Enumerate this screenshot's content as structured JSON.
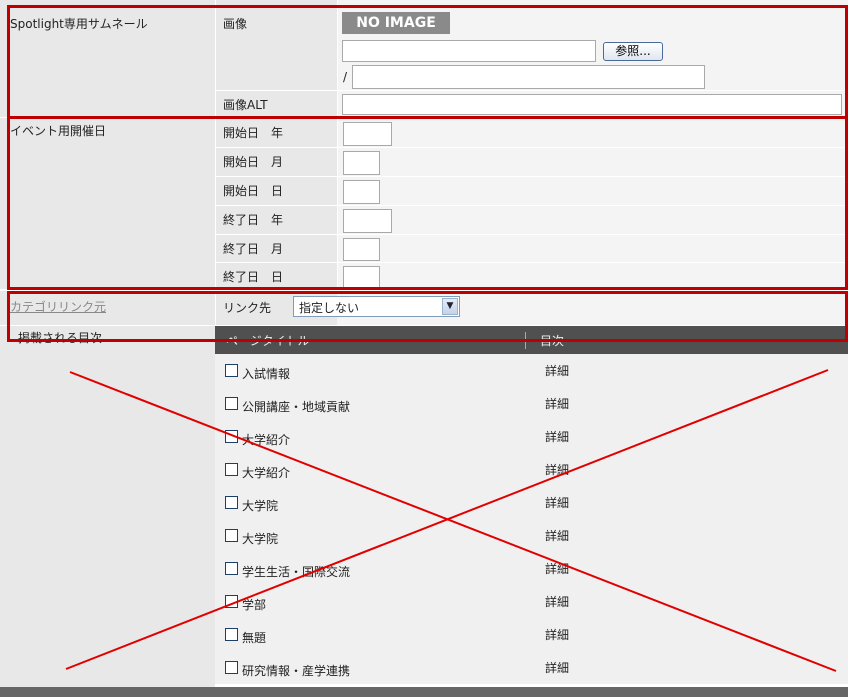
{
  "thumbnail": {
    "label": "Spotlight専用サムネール",
    "image_label": "画像",
    "no_image_text": "NO IMAGE",
    "browse_button": "参照...",
    "path_prefix": "/",
    "alt_label": "画像ALT",
    "file_value": "",
    "path_value": "",
    "alt_value": ""
  },
  "event": {
    "label": "イベント用開催日",
    "fields": [
      {
        "label": "開始日　年",
        "value": ""
      },
      {
        "label": "開始日　月",
        "value": ""
      },
      {
        "label": "開始日　日",
        "value": ""
      },
      {
        "label": "終了日　年",
        "value": ""
      },
      {
        "label": "終了日　月",
        "value": ""
      },
      {
        "label": "終了日　日",
        "value": ""
      }
    ]
  },
  "category": {
    "label": "カテゴリリンク元",
    "link_label": "リンク先",
    "select_value": "指定しない"
  },
  "toc": {
    "label": "掲載される目次",
    "col_title": "ページタイトル",
    "col_toc": "目次",
    "detail_text": "詳細",
    "rows": [
      {
        "title": "入試情報"
      },
      {
        "title": "公開講座・地域貢献"
      },
      {
        "title": "大学紹介"
      },
      {
        "title": "大学紹介"
      },
      {
        "title": "大学院"
      },
      {
        "title": "大学院"
      },
      {
        "title": "学生生活・国際交流"
      },
      {
        "title": "学部"
      },
      {
        "title": "無題"
      },
      {
        "title": "研究情報・産学連携"
      }
    ]
  },
  "colors": {
    "annotation_red": "#c00000",
    "cross_red": "#e00000",
    "header_dark": "#505050"
  }
}
